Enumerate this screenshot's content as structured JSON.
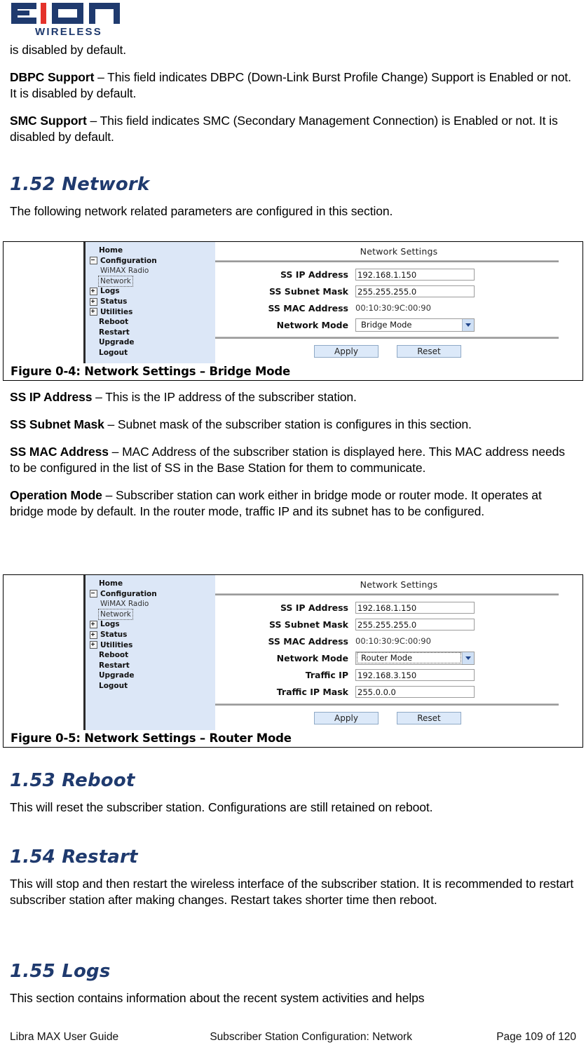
{
  "brand": {
    "name": "EiON",
    "tagline": "WIRELESS",
    "navy": "#1F3A6E",
    "red": "#E4322B"
  },
  "intro": {
    "continued_line": "is disabled by default.",
    "dbpc_term": "DBPC Support",
    "dbpc_text": " – This field indicates DBPC (Down-Link Burst Profile Change) Support is Enabled or not. It is disabled by default.",
    "smc_term": "SMC Support",
    "smc_text": " – This field indicates SMC (Secondary Management Connection) is Enabled or not. It is disabled by default."
  },
  "sections": {
    "network": {
      "heading": "1.52 Network",
      "intro": "The following network related parameters are configured in this section."
    },
    "reboot": {
      "heading": "1.53 Reboot",
      "text": "This will reset the subscriber station. Configurations are still retained on reboot."
    },
    "restart": {
      "heading": "1.54 Restart",
      "text": "This will stop and then restart the wireless interface of the subscriber station. It is recommended to restart subscriber station after making changes. Restart takes shorter time then reboot."
    },
    "logs": {
      "heading": "1.55 Logs",
      "text": "This section contains information about the recent system activities and helps"
    }
  },
  "definitions": [
    {
      "term": "SS IP Address",
      "text": " – This is the IP address of the subscriber station."
    },
    {
      "term": "SS Subnet Mask",
      "text": " – Subnet mask of the subscriber station is configures in this section."
    },
    {
      "term": "SS MAC Address",
      "text": " – MAC Address of the subscriber station is displayed here. This MAC address needs to be configured in the list of SS in the Base Station for them to communicate."
    },
    {
      "term": "Operation Mode",
      "text": " – Subscriber station can work either in bridge mode or router mode. It operates at bridge mode by default. In the router mode, traffic IP and its subnet has to be configured."
    }
  ],
  "sidebar_tree": {
    "items": [
      {
        "label": "Home",
        "icon": "none",
        "bold": true,
        "child": false
      },
      {
        "label": "Configuration",
        "icon": "minus",
        "bold": true,
        "child": false
      },
      {
        "label": "WiMAX Radio",
        "icon": "none",
        "bold": false,
        "child": true
      },
      {
        "label": "Network",
        "icon": "none",
        "bold": false,
        "child": true,
        "focused": true
      },
      {
        "label": "Logs",
        "icon": "plus",
        "bold": true,
        "child": false
      },
      {
        "label": "Status",
        "icon": "plus",
        "bold": true,
        "child": false
      },
      {
        "label": "Utilities",
        "icon": "plus",
        "bold": true,
        "child": false
      },
      {
        "label": "Reboot",
        "icon": "none",
        "bold": true,
        "child": false
      },
      {
        "label": "Restart",
        "icon": "none",
        "bold": true,
        "child": false
      },
      {
        "label": "Upgrade",
        "icon": "none",
        "bold": true,
        "child": false
      },
      {
        "label": "Logout",
        "icon": "none",
        "bold": true,
        "child": false
      }
    ]
  },
  "figures": [
    {
      "number": "Figure 0-4:",
      "caption": "Figure 0-4: Network Settings – Bridge Mode",
      "panel_title": "Network Settings",
      "fields": [
        {
          "label": "SS IP Address",
          "type": "input",
          "value": "192.168.1.150"
        },
        {
          "label": "SS Subnet Mask",
          "type": "input",
          "value": "255.255.255.0"
        },
        {
          "label": "SS MAC Address",
          "type": "static",
          "value": "00:10:30:9C:00:90"
        },
        {
          "label": "Network Mode",
          "type": "select",
          "value": "Bridge Mode",
          "focused": false
        }
      ],
      "buttons": {
        "apply": "Apply",
        "reset": "Reset"
      }
    },
    {
      "number": "Figure 0-5:",
      "caption": "Figure 0-5: Network Settings – Router Mode",
      "panel_title": "Network Settings",
      "fields": [
        {
          "label": "SS IP Address",
          "type": "input",
          "value": "192.168.1.150"
        },
        {
          "label": "SS Subnet Mask",
          "type": "input",
          "value": "255.255.255.0"
        },
        {
          "label": "SS MAC Address",
          "type": "static",
          "value": "00:10:30:9C:00:90"
        },
        {
          "label": "Network Mode",
          "type": "select",
          "value": "Router Mode",
          "focused": true
        },
        {
          "label": "Traffic IP",
          "type": "input",
          "value": "192.168.3.150"
        },
        {
          "label": "Traffic IP Mask",
          "type": "input",
          "value": "255.0.0.0"
        }
      ],
      "buttons": {
        "apply": "Apply",
        "reset": "Reset"
      }
    }
  ],
  "footer": {
    "left": "Libra MAX User Guide",
    "center": "Subscriber Station Configuration: Network",
    "right": "Page 109 of 120"
  }
}
